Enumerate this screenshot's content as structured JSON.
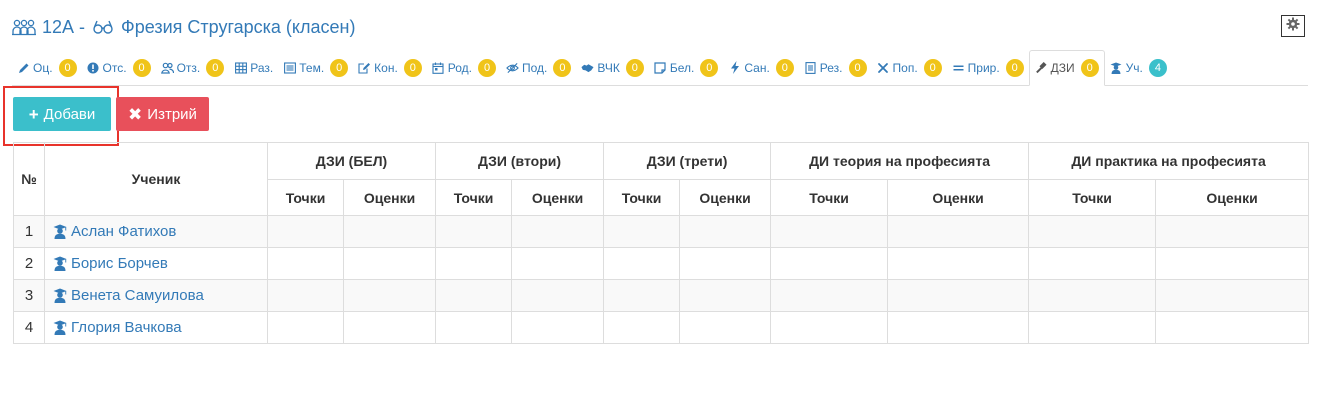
{
  "header": {
    "class_name": "12А -",
    "teacher_name": "Фрезия Стругарска (класен)",
    "class_icon": "group-icon",
    "teacher_icon": "glasses-icon"
  },
  "settings": {
    "icon": "gear-icon"
  },
  "tabs": [
    {
      "label": "Оц.",
      "badge": "0",
      "icon": "pencil-icon"
    },
    {
      "label": "Отс.",
      "badge": "0",
      "icon": "exclamation-circle-icon"
    },
    {
      "label": "Отз.",
      "badge": "0",
      "icon": "users-icon"
    },
    {
      "label": "Раз.",
      "badge": "",
      "icon": "table-icon"
    },
    {
      "label": "Тем.",
      "badge": "0",
      "icon": "list-alt-icon"
    },
    {
      "label": "Кон.",
      "badge": "0",
      "icon": "edit-icon"
    },
    {
      "label": "Род.",
      "badge": "0",
      "icon": "calendar-icon"
    },
    {
      "label": "Под.",
      "badge": "0",
      "icon": "eye-slash-icon"
    },
    {
      "label": "ВЧК",
      "badge": "0",
      "icon": "handshake-icon"
    },
    {
      "label": "Бел.",
      "badge": "0",
      "icon": "sticky-note-icon"
    },
    {
      "label": "Сан.",
      "badge": "0",
      "icon": "bolt-icon"
    },
    {
      "label": "Рез.",
      "badge": "0",
      "icon": "file-text-icon"
    },
    {
      "label": "Поп.",
      "badge": "0",
      "icon": "wrench-icon"
    },
    {
      "label": "Прир.",
      "badge": "0",
      "icon": "equals-icon"
    },
    {
      "label": "ДЗИ",
      "badge": "0",
      "icon": "gavel-icon"
    },
    {
      "label": "Уч.",
      "badge": "4",
      "icon": "graduate-icon"
    }
  ],
  "buttons": {
    "add_label": "Добави",
    "delete_label": "Изтрий"
  },
  "table": {
    "col_num": "№",
    "col_student": "Ученик",
    "groups": [
      "ДЗИ (БЕЛ)",
      "ДЗИ (втори)",
      "ДЗИ (трети)",
      "ДИ теория на професията",
      "ДИ практика на професията"
    ],
    "sub_points": "Точки",
    "sub_grades": "Оценки",
    "rows": [
      {
        "num": "1",
        "name": "Аслан Фатихов"
      },
      {
        "num": "2",
        "name": "Борис Борчев"
      },
      {
        "num": "3",
        "name": "Венета Самуилова"
      },
      {
        "num": "4",
        "name": "Глория Вачкова"
      }
    ]
  },
  "colors": {
    "link": "#337ab7",
    "badge_yellow": "#f0c419",
    "badge_teal": "#3ac0cb",
    "add_button": "#3bbfcb",
    "delete_button": "#e8505b",
    "highlight": "#e8332b"
  }
}
